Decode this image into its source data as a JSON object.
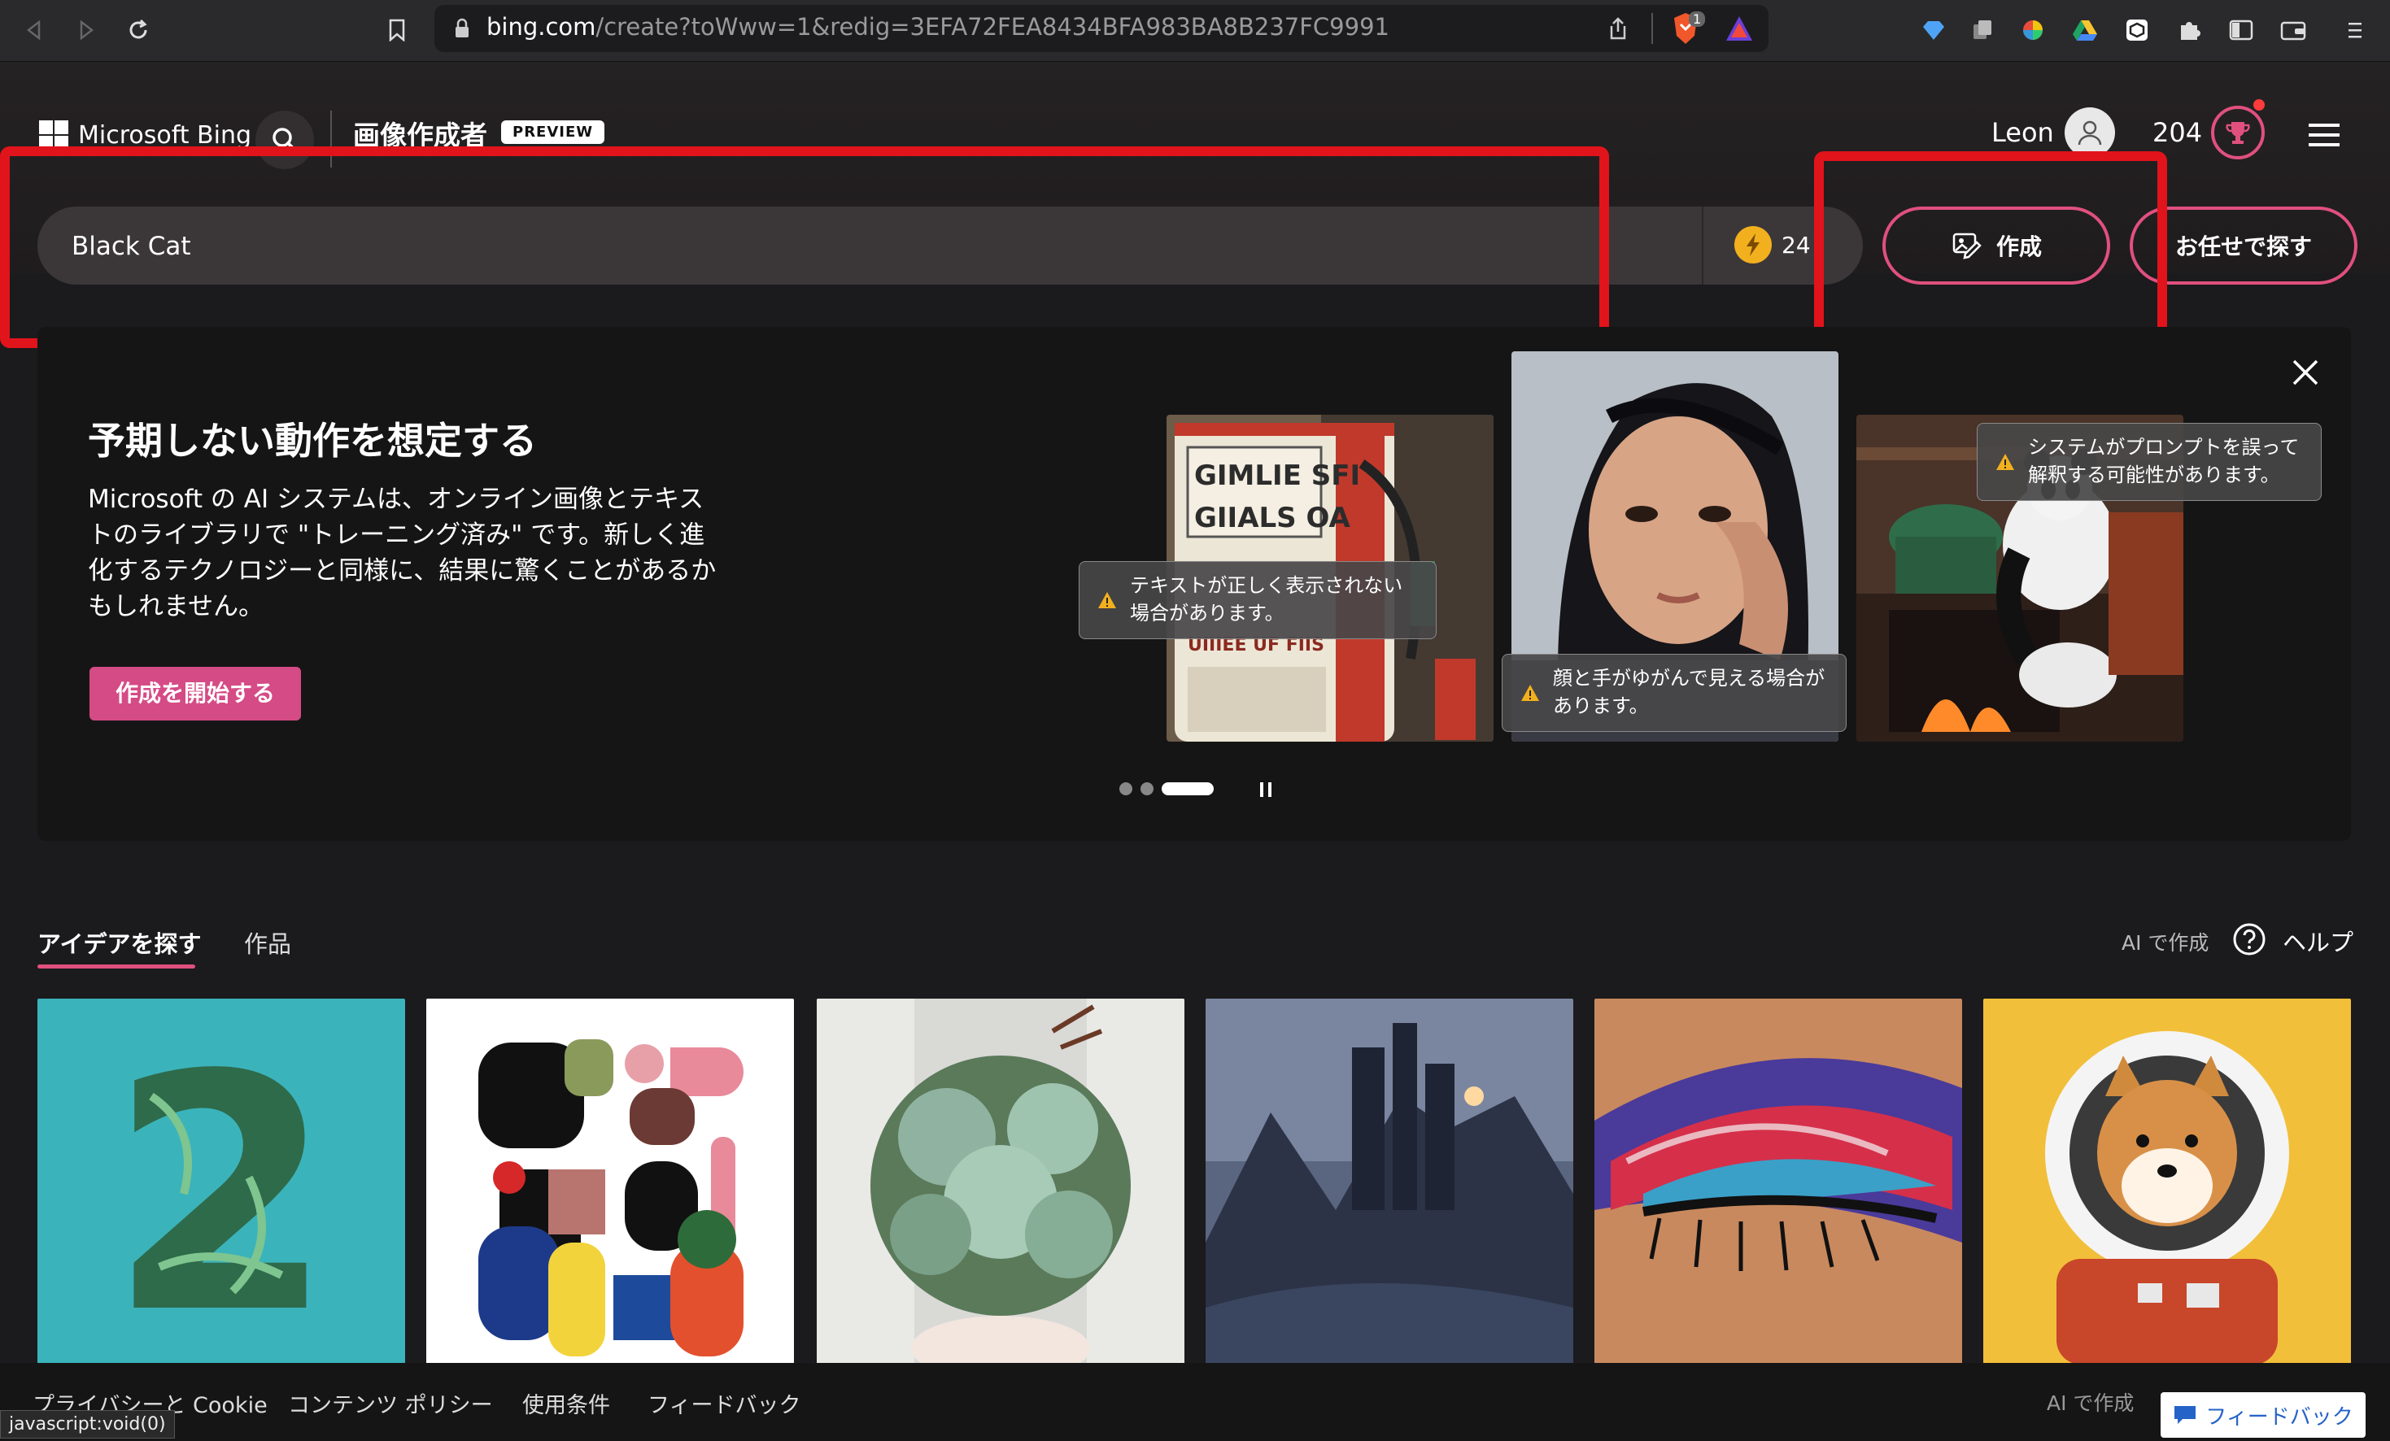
{
  "browser": {
    "url_domain": "bing.com",
    "url_path": "/create?toWww=1&redig=3EFA72FEA8434BFA983BA8B237FC9991",
    "brave_badge": "1"
  },
  "header": {
    "logo_text": "Microsoft Bing",
    "page_title": "画像作成者",
    "badge": "PREVIEW",
    "user_name": "Leon",
    "points": "204"
  },
  "prompt": {
    "value": "Black Cat",
    "boosts": "24",
    "create_label": "作成",
    "surprise_label": "お任せで探す"
  },
  "banner": {
    "title": "予期しない動作を想定する",
    "text": "Microsoft の AI システムは、オンライン画像とテキストのライブラリで \"トレーニング済み\" です。新しく進化するテクノロジーと同様に、結果に驚くことがあるかもしれません。",
    "start_label": "作成を開始する",
    "tooltip_text": "テキストが正しく表示されない場合があります。",
    "tooltip_face": "顔と手がゆがんで見える場合があります。",
    "tooltip_prompt": "システムがプロンプトを誤って解釈する可能性があります。",
    "sign_line1": "GIMLIE SFI",
    "sign_line2": "GIIALS OA",
    "sign_line3": "UIIIEE UF FIIS"
  },
  "tabs": {
    "ideas": "アイデアを探す",
    "works": "作品",
    "ai_made": "AI で作成",
    "help": "ヘルプ"
  },
  "gallery": {
    "digit": "2"
  },
  "footer": {
    "privacy": "プライバシーと Cookie",
    "content_policy": "コンテンツ ポリシー",
    "terms": "使用条件",
    "feedback": "フィードバック",
    "ai_made": "AI で作成",
    "status": "javascript:void(0)",
    "feedback_button": "フィードバック"
  },
  "colors": {
    "accent_pink": "#e0507e",
    "annotation_red": "#e1131b",
    "background": "#1b1a1c"
  }
}
